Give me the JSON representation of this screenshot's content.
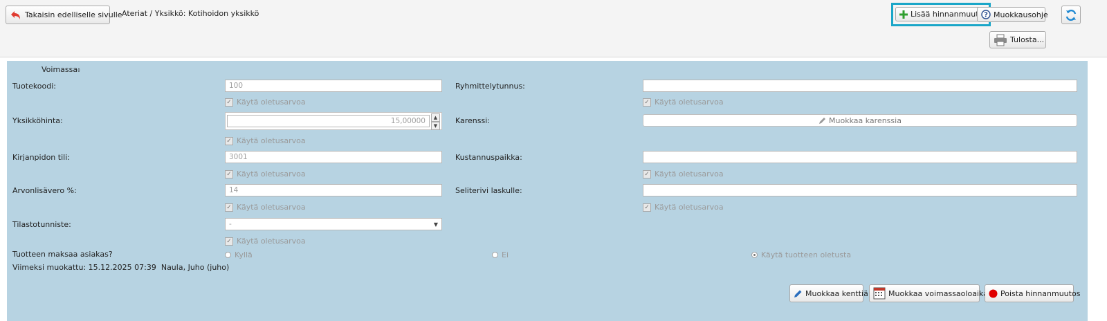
{
  "header": {
    "back_label": "Takaisin edelliselle sivulle",
    "breadcrumb": "Ateriat / Yksikkö: Kotihoidon yksikkö",
    "add_price_change_label": "Lisää hinnanmuutos",
    "edit_help_label": "Muokkausohje",
    "print_label": "Tulosta..."
  },
  "form": {
    "voimassa_label": "Voimassa:",
    "voimassa_value": "-",
    "use_default": "Käytä oletusarvoa",
    "product_code": {
      "label": "Tuotekoodi:",
      "value": "100"
    },
    "group_code": {
      "label": "Ryhmittelytunnus:",
      "value": ""
    },
    "unit_price": {
      "label": "Yksikköhinta:",
      "value": "15,00000"
    },
    "karenssi": {
      "label": "Karenssi:",
      "button": "Muokkaa karenssia"
    },
    "account": {
      "label": "Kirjanpidon tili:",
      "value": "3001"
    },
    "cost_center": {
      "label": "Kustannuspaikka:",
      "value": ""
    },
    "vat": {
      "label": "Arvonlisävero %:",
      "value": "14"
    },
    "invoice_text": {
      "label": "Seliterivi laskulle:",
      "value": ""
    },
    "stat_id": {
      "label": "Tilastotunniste:",
      "value": "-"
    },
    "customer_pays": {
      "label": "Tuotteen maksaa asiakas?",
      "options": [
        "Kyllä",
        "Ei",
        "Käytä tuotteen oletusta"
      ],
      "selected": "Käytä tuotteen oletusta"
    },
    "last_modified": "Viimeksi muokattu: 15.12.2025 07:39  Naula, Juho (juho)"
  },
  "actions": {
    "edit_fields": "Muokkaa kenttiä",
    "edit_validity": "Muokkaa voimassaoloaikaa",
    "delete_price_change": "Poista hinnanmuutos"
  },
  "colors": {
    "panel_bg": "#b7d3e2",
    "highlight_border": "#1aa6c8",
    "add_icon": "#2e9e2e",
    "back_arrow": "#e03c31",
    "delete_dot": "#e00000"
  }
}
